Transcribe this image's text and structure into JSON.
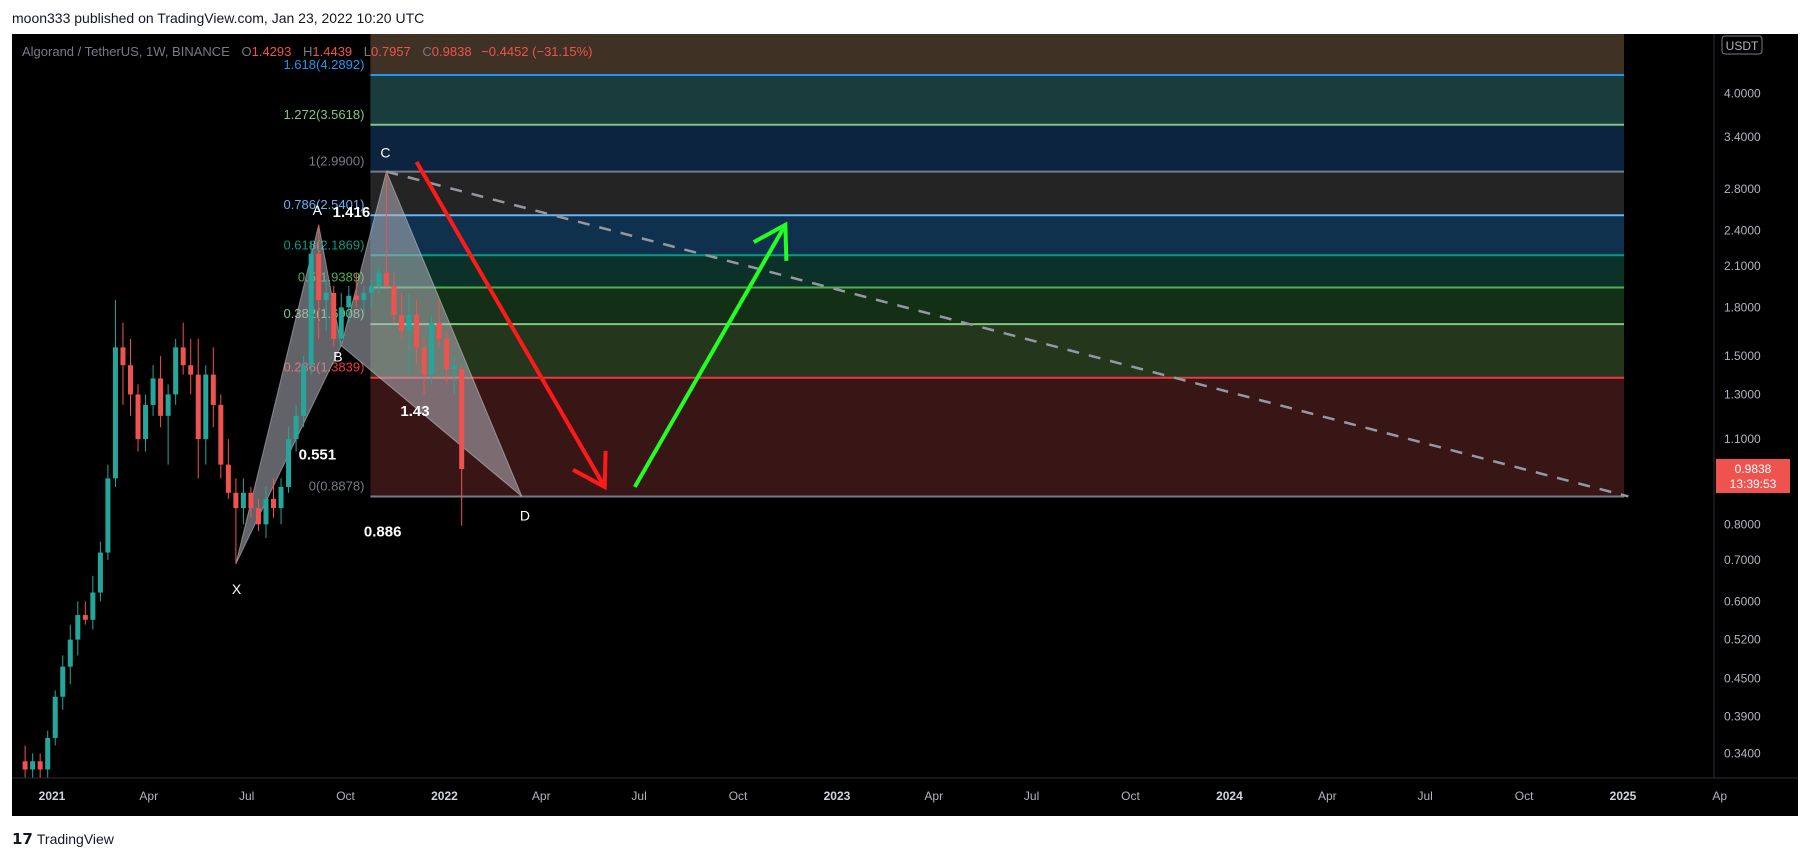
{
  "header": {
    "publisher": "moon333 published on TradingView.com, Jan 23, 2022 10:20 UTC"
  },
  "legend": {
    "symbol": "Algorand / TetherUS, 1W, BINANCE",
    "open_label": "O",
    "open": "1.4293",
    "high_label": "H",
    "high": "1.4439",
    "low_label": "L",
    "low": "0.7957",
    "close_label": "C",
    "close": "0.9838",
    "change": "−0.4452 (−31.15%)"
  },
  "footer": {
    "logo_text": "TradingView"
  },
  "chart_data": {
    "type": "candlestick",
    "scale": "log",
    "currency": "USDT",
    "ylim": [
      0.31,
      5.0
    ],
    "y_ticks": [
      "4.0000",
      "3.4000",
      "2.8000",
      "2.4000",
      "2.1000",
      "1.8000",
      "1.5000",
      "1.3000",
      "1.1000",
      "0.8000",
      "0.7000",
      "0.6000",
      "0.5200",
      "0.4500",
      "0.3900",
      "0.3400"
    ],
    "x_ticks": [
      "2021",
      "Apr",
      "Jul",
      "Oct",
      "2022",
      "Apr",
      "Jul",
      "Oct",
      "2023",
      "Apr",
      "Jul",
      "Oct",
      "2024",
      "Apr",
      "Jul",
      "Oct",
      "2025",
      "Ap"
    ],
    "price_label": {
      "value": "0.9838",
      "countdown": "13:39:53",
      "color": "#ef5350"
    },
    "fib_levels": [
      {
        "label": "1.618(4.2892)",
        "ratio": 1.618,
        "price": 4.2892,
        "color": "#2196f3"
      },
      {
        "label": "1.272(3.5618)",
        "ratio": 1.272,
        "price": 3.5618,
        "color": "#81c784"
      },
      {
        "label": "1(2.9900)",
        "ratio": 1,
        "price": 2.99,
        "color": "#787b86"
      },
      {
        "label": "0.786(2.5401)",
        "ratio": 0.786,
        "price": 2.5401,
        "color": "#64b5f6"
      },
      {
        "label": "0.618(2.1869)",
        "ratio": 0.618,
        "price": 2.1869,
        "color": "#089981"
      },
      {
        "label": "0.5(1.9389)",
        "ratio": 0.5,
        "price": 1.9389,
        "color": "#4caf50"
      },
      {
        "label": "0.382(1.6908)",
        "ratio": 0.382,
        "price": 1.6908,
        "color": "#81c784"
      },
      {
        "label": "0.236(1.3839)",
        "ratio": 0.236,
        "price": 1.3839,
        "color": "#f23645"
      },
      {
        "label": "0(0.8878)",
        "ratio": 0,
        "price": 0.8878,
        "color": "#787b86"
      }
    ],
    "fib_top_price": 5.0,
    "fib_zone_colors": [
      "#4a3a2a",
      "#1d4848",
      "#0e2a4a",
      "#2a2a2a",
      "#123a5a",
      "#0d3a30",
      "#16381a",
      "#2a4020",
      "#431a1a"
    ],
    "harmonic_points": [
      {
        "label": "X",
        "date": "2021-06-21",
        "price": 0.69
      },
      {
        "label": "A",
        "date": "2021-09-06",
        "price": 2.45
      },
      {
        "label": "B",
        "date": "2021-09-27",
        "price": 1.56
      },
      {
        "label": "C",
        "date": "2021-11-08",
        "price": 2.99
      },
      {
        "label": "D",
        "date": "2022-03-14",
        "price": 0.8878
      }
    ],
    "harmonic_ratios": [
      "1.416",
      "0.551",
      "1.43",
      "0.886"
    ],
    "trendline": {
      "from": {
        "date": "2021-11-08",
        "price": 2.99
      },
      "to": {
        "date": "2025-01-06",
        "price": 0.8878
      }
    },
    "arrows": [
      {
        "color": "#ff1a1a",
        "from": {
          "date": "2021-12-06",
          "price": 3.1
        },
        "to": {
          "date": "2022-05-30",
          "price": 0.92
        }
      },
      {
        "color": "#22ff22",
        "from": {
          "date": "2022-06-27",
          "price": 0.92
        },
        "to": {
          "date": "2022-11-14",
          "price": 2.45
        }
      }
    ],
    "candles": [
      [
        "2020-12-07",
        0.33,
        0.35,
        0.31,
        0.32
      ],
      [
        "2020-12-14",
        0.32,
        0.34,
        0.31,
        0.33
      ],
      [
        "2020-12-21",
        0.33,
        0.34,
        0.31,
        0.32
      ],
      [
        "2020-12-28",
        0.32,
        0.37,
        0.31,
        0.36
      ],
      [
        "2021-01-04",
        0.36,
        0.43,
        0.35,
        0.42
      ],
      [
        "2021-01-11",
        0.42,
        0.49,
        0.4,
        0.47
      ],
      [
        "2021-01-18",
        0.47,
        0.55,
        0.44,
        0.52
      ],
      [
        "2021-01-25",
        0.52,
        0.6,
        0.49,
        0.57
      ],
      [
        "2021-02-01",
        0.57,
        0.6,
        0.55,
        0.56
      ],
      [
        "2021-02-08",
        0.56,
        0.66,
        0.54,
        0.62
      ],
      [
        "2021-02-15",
        0.62,
        0.75,
        0.6,
        0.72
      ],
      [
        "2021-02-22",
        0.72,
        1.0,
        0.7,
        0.95
      ],
      [
        "2021-03-01",
        0.95,
        1.85,
        0.92,
        1.55
      ],
      [
        "2021-03-08",
        1.55,
        1.7,
        1.25,
        1.45
      ],
      [
        "2021-03-15",
        1.45,
        1.6,
        1.2,
        1.3
      ],
      [
        "2021-03-22",
        1.3,
        1.35,
        1.05,
        1.1
      ],
      [
        "2021-03-29",
        1.1,
        1.3,
        1.05,
        1.25
      ],
      [
        "2021-04-05",
        1.25,
        1.45,
        1.2,
        1.38
      ],
      [
        "2021-04-12",
        1.38,
        1.5,
        1.15,
        1.2
      ],
      [
        "2021-04-19",
        1.2,
        1.35,
        1.0,
        1.3
      ],
      [
        "2021-04-26",
        1.3,
        1.6,
        1.25,
        1.55
      ],
      [
        "2021-05-03",
        1.55,
        1.7,
        1.4,
        1.45
      ],
      [
        "2021-05-10",
        1.45,
        1.6,
        1.3,
        1.4
      ],
      [
        "2021-05-17",
        1.4,
        1.6,
        0.95,
        1.1
      ],
      [
        "2021-05-24",
        1.1,
        1.45,
        1.0,
        1.4
      ],
      [
        "2021-05-31",
        1.4,
        1.55,
        1.15,
        1.25
      ],
      [
        "2021-06-07",
        1.25,
        1.3,
        0.95,
        1.0
      ],
      [
        "2021-06-14",
        1.0,
        1.1,
        0.88,
        0.9
      ],
      [
        "2021-06-21",
        0.9,
        0.95,
        0.69,
        0.85
      ],
      [
        "2021-06-28",
        0.85,
        0.95,
        0.8,
        0.9
      ],
      [
        "2021-07-05",
        0.9,
        0.92,
        0.82,
        0.85
      ],
      [
        "2021-07-12",
        0.85,
        0.88,
        0.78,
        0.8
      ],
      [
        "2021-07-19",
        0.8,
        0.92,
        0.76,
        0.88
      ],
      [
        "2021-07-26",
        0.88,
        0.95,
        0.82,
        0.85
      ],
      [
        "2021-08-02",
        0.85,
        0.95,
        0.8,
        0.92
      ],
      [
        "2021-08-09",
        0.92,
        1.15,
        0.9,
        1.1
      ],
      [
        "2021-08-16",
        1.1,
        1.25,
        1.05,
        1.2
      ],
      [
        "2021-08-23",
        1.2,
        1.5,
        1.15,
        1.45
      ],
      [
        "2021-08-30",
        1.45,
        2.3,
        1.4,
        2.2
      ],
      [
        "2021-09-06",
        2.2,
        2.45,
        1.6,
        1.85
      ],
      [
        "2021-09-13",
        1.85,
        2.0,
        1.65,
        1.9
      ],
      [
        "2021-09-20",
        1.9,
        1.95,
        1.55,
        1.6
      ],
      [
        "2021-09-27",
        1.6,
        1.9,
        1.56,
        1.8
      ],
      [
        "2021-10-04",
        1.8,
        1.95,
        1.7,
        1.88
      ],
      [
        "2021-10-11",
        1.88,
        2.05,
        1.8,
        1.85
      ],
      [
        "2021-10-18",
        1.85,
        1.95,
        1.75,
        1.9
      ],
      [
        "2021-10-25",
        1.9,
        2.0,
        1.8,
        1.95
      ],
      [
        "2021-11-01",
        1.95,
        2.1,
        1.9,
        2.05
      ],
      [
        "2021-11-08",
        2.05,
        2.99,
        2.0,
        1.95
      ],
      [
        "2021-11-15",
        1.95,
        2.05,
        1.7,
        1.75
      ],
      [
        "2021-11-22",
        1.75,
        1.9,
        1.6,
        1.65
      ],
      [
        "2021-11-29",
        1.65,
        1.9,
        1.4,
        1.75
      ],
      [
        "2021-12-06",
        1.75,
        1.85,
        1.45,
        1.55
      ],
      [
        "2021-12-13",
        1.55,
        1.6,
        1.3,
        1.4
      ],
      [
        "2021-12-20",
        1.4,
        1.75,
        1.35,
        1.7
      ],
      [
        "2021-12-27",
        1.7,
        1.85,
        1.55,
        1.6
      ],
      [
        "2022-01-03",
        1.6,
        1.65,
        1.35,
        1.43
      ],
      [
        "2022-01-10",
        1.43,
        1.5,
        1.3,
        1.45
      ],
      [
        "2022-01-17",
        1.4293,
        1.4439,
        0.7957,
        0.9838
      ]
    ]
  }
}
